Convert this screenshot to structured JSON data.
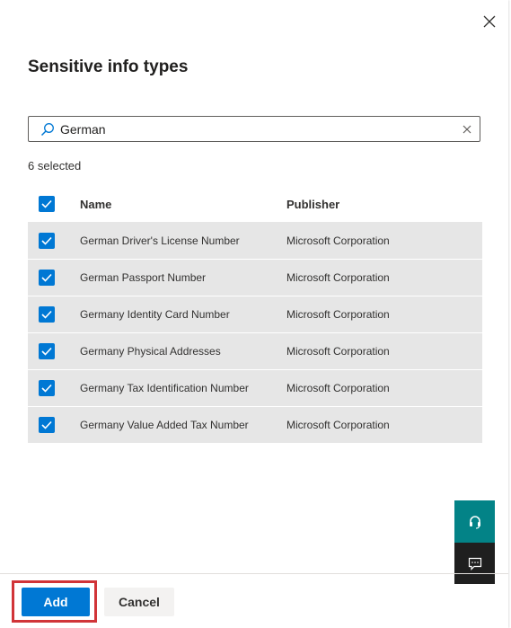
{
  "panel": {
    "title": "Sensitive info types",
    "close_icon": "close-icon"
  },
  "search": {
    "value": "German",
    "placeholder": "Search",
    "icon": "search-icon",
    "clear_icon": "clear-icon"
  },
  "selection": {
    "count_text": "6 selected"
  },
  "table": {
    "columns": [
      "Name",
      "Publisher"
    ],
    "header_checked": true,
    "rows": [
      {
        "name": "German Driver's License Number",
        "publisher": "Microsoft Corporation",
        "checked": true
      },
      {
        "name": "German Passport Number",
        "publisher": "Microsoft Corporation",
        "checked": true
      },
      {
        "name": "Germany Identity Card Number",
        "publisher": "Microsoft Corporation",
        "checked": true
      },
      {
        "name": "Germany Physical Addresses",
        "publisher": "Microsoft Corporation",
        "checked": true
      },
      {
        "name": "Germany Tax Identification Number",
        "publisher": "Microsoft Corporation",
        "checked": true
      },
      {
        "name": "Germany Value Added Tax Number",
        "publisher": "Microsoft Corporation",
        "checked": true
      }
    ]
  },
  "side_buttons": {
    "help_icon": "headset-icon",
    "feedback_icon": "chat-icon"
  },
  "footer": {
    "add_label": "Add",
    "cancel_label": "Cancel"
  },
  "colors": {
    "accent": "#0078d4",
    "row_bg": "#e6e6e6",
    "help_bg": "#038387",
    "feedback_bg": "#1f1f1f",
    "highlight": "#d13438"
  }
}
